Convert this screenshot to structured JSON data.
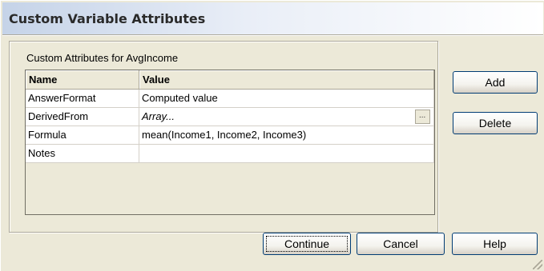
{
  "dialog": {
    "title": "Custom Variable Attributes",
    "caption": "Custom Attributes for AvgIncome"
  },
  "grid": {
    "columns": [
      "Name",
      "Value"
    ],
    "rows": [
      {
        "name": "AnswerFormat",
        "value": "Computed value"
      },
      {
        "name": "DerivedFrom",
        "value": "Array...",
        "ellipsis": "..."
      },
      {
        "name": "Formula",
        "value": "mean(Income1, Income2, Income3)"
      },
      {
        "name": "Notes",
        "value": ""
      }
    ]
  },
  "buttons": {
    "add": "Add",
    "delete": "Delete",
    "continue": "Continue",
    "cancel": "Cancel",
    "help": "Help"
  },
  "colors": {
    "dialog_bg": "#ece9d8",
    "button_border": "#003c74"
  }
}
